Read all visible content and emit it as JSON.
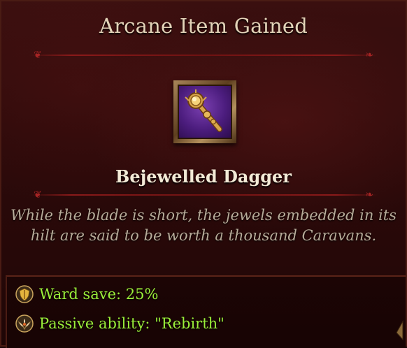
{
  "popup": {
    "title": "Arcane Item Gained",
    "item": {
      "name": "Bejewelled Dagger",
      "icon": "scepter-icon",
      "description": "While the blade is short, the jewels embedded in its hilt are said to be worth a thousand Caravans."
    },
    "effects": [
      {
        "icon": "ward-shield-icon",
        "text": "Ward save: 25%"
      },
      {
        "icon": "phoenix-icon",
        "text": "Passive ability: \"Rebirth\""
      }
    ],
    "colors": {
      "title": "#e3d3b8",
      "item_name": "#f3ead6",
      "description": "#b7ab99",
      "effect_text": "#9bef3a",
      "background": "#2c0a0a",
      "item_background": "#4c1d7e"
    }
  }
}
